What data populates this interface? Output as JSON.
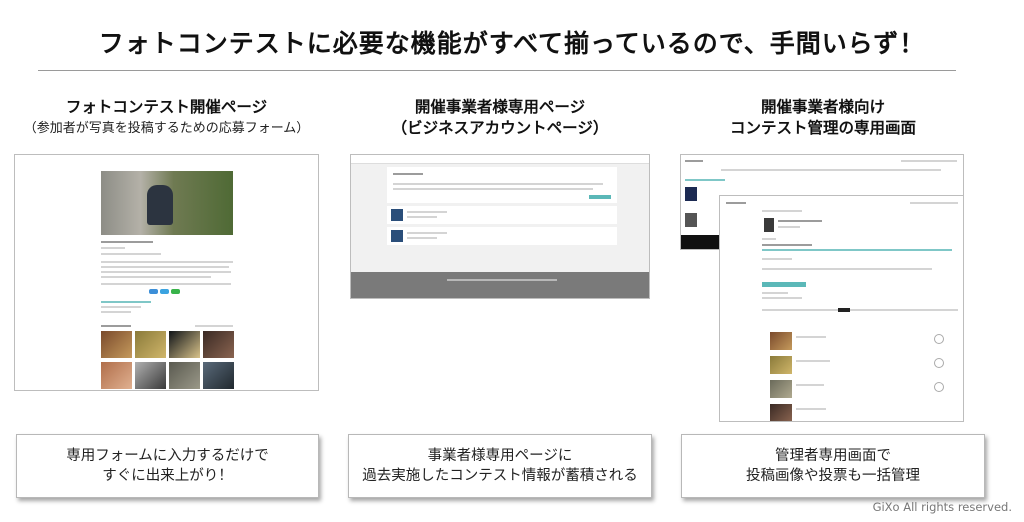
{
  "headline": "フォトコンテストに必要な機能がすべて揃っているので、手間いらず！",
  "columns": [
    {
      "title_lines": [
        "フォトコンテスト開催ページ"
      ],
      "subtitle": "（参加者が写真を投稿するための応募フォーム）",
      "caption_lines": [
        "専用フォームに入力するだけで",
        "すぐに出来上がり！"
      ]
    },
    {
      "title_lines": [
        "開催事業者様専用ページ",
        "（ビジネスアカウントページ）"
      ],
      "subtitle": "",
      "caption_lines": [
        "事業者様専用ページに",
        "過去実施したコンテスト情報が蓄積される"
      ]
    },
    {
      "title_lines": [
        "開催事業者様向け",
        "コンテスト管理の専用画面"
      ],
      "subtitle": "",
      "caption_lines": [
        "管理者専用画面で",
        "投稿画像や投票も一括管理"
      ]
    }
  ],
  "copyright": "GiXo All rights reserved.",
  "colors": {
    "text": "#111111",
    "rule": "#9a9a9a",
    "footer_gray": "#7a7a7a",
    "accent_teal": "#5bb8b8",
    "accent_blue": "#3c8fd8"
  }
}
